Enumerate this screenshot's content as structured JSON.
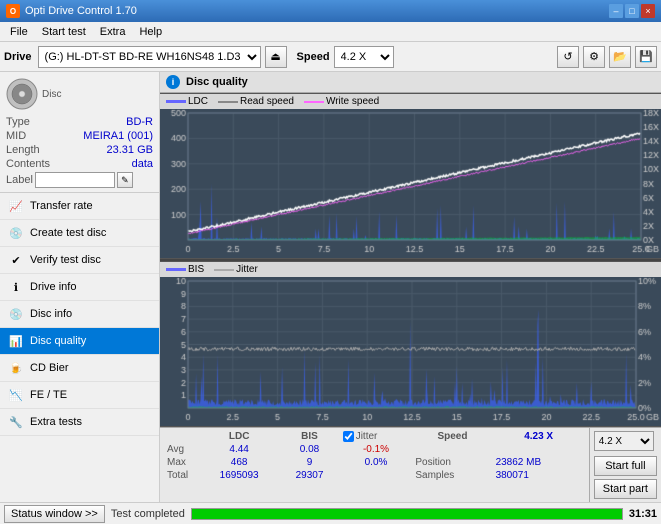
{
  "titlebar": {
    "title": "Opti Drive Control 1.70",
    "icon": "O",
    "buttons": {
      "minimize": "–",
      "maximize": "□",
      "close": "×"
    }
  },
  "menubar": {
    "items": [
      "File",
      "Start test",
      "Extra",
      "Help"
    ]
  },
  "toolbar": {
    "drive_label": "Drive",
    "drive_value": "(G:)  HL-DT-ST BD-RE  WH16NS48 1.D3",
    "speed_label": "Speed",
    "speed_value": "4.2 X"
  },
  "disc": {
    "type_label": "Type",
    "type_value": "BD-R",
    "mid_label": "MID",
    "mid_value": "MEIRA1 (001)",
    "length_label": "Length",
    "length_value": "23.31 GB",
    "contents_label": "Contents",
    "contents_value": "data",
    "label_label": "Label"
  },
  "nav": {
    "items": [
      {
        "id": "transfer-rate",
        "label": "Transfer rate",
        "icon": "📈"
      },
      {
        "id": "create-test-disc",
        "label": "Create test disc",
        "icon": "💿"
      },
      {
        "id": "verify-test-disc",
        "label": "Verify test disc",
        "icon": "✔"
      },
      {
        "id": "drive-info",
        "label": "Drive info",
        "icon": "ℹ"
      },
      {
        "id": "disc-info",
        "label": "Disc info",
        "icon": "💿"
      },
      {
        "id": "disc-quality",
        "label": "Disc quality",
        "icon": "📊",
        "active": true
      },
      {
        "id": "cd-bier",
        "label": "CD Bier",
        "icon": "🍺"
      },
      {
        "id": "fe-te",
        "label": "FE / TE",
        "icon": "📉"
      },
      {
        "id": "extra-tests",
        "label": "Extra tests",
        "icon": "🔧"
      }
    ]
  },
  "chart": {
    "title": "Disc quality",
    "upper": {
      "title": "LDC",
      "legend": [
        {
          "label": "LDC",
          "color": "#4040ff"
        },
        {
          "label": "Read speed",
          "color": "#ffffff"
        },
        {
          "label": "Write speed",
          "color": "#ff00ff"
        }
      ],
      "y_max": 500,
      "y_right_max": 18,
      "x_max": 25,
      "x_label": "GB"
    },
    "lower": {
      "title": "BIS",
      "legend": [
        {
          "label": "BIS",
          "color": "#4040ff"
        },
        {
          "label": "Jitter",
          "color": "#ffffff"
        }
      ],
      "y_max": 10,
      "y_right_max": 10,
      "x_max": 25,
      "x_label": "GB"
    }
  },
  "stats": {
    "headers": [
      "",
      "LDC",
      "BIS",
      "",
      "Jitter",
      "Speed",
      ""
    ],
    "avg_label": "Avg",
    "avg_ldc": "4.44",
    "avg_bis": "0.08",
    "avg_jitter": "-0.1%",
    "max_label": "Max",
    "max_ldc": "468",
    "max_bis": "9",
    "max_jitter": "0.0%",
    "total_label": "Total",
    "total_ldc": "1695093",
    "total_bis": "29307",
    "jitter_checked": true,
    "jitter_label": "Jitter",
    "speed_label": "Speed",
    "speed_value": "4.23 X",
    "speed_select": "4.2 X",
    "position_label": "Position",
    "position_value": "23862 MB",
    "samples_label": "Samples",
    "samples_value": "380071",
    "start_full_label": "Start full",
    "start_part_label": "Start part"
  },
  "statusbar": {
    "window_btn": "Status window >>",
    "status_text": "Test completed",
    "progress": 100,
    "time": "31:31"
  }
}
